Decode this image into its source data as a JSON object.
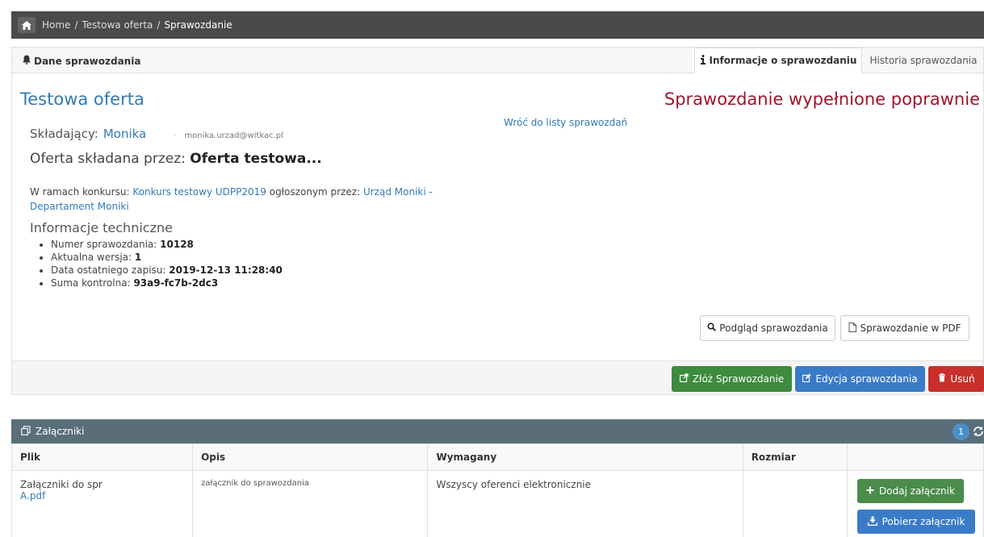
{
  "breadcrumb": {
    "home": "Home",
    "offer": "Testowa oferta",
    "current": "Sprawozdanie",
    "separator": "/"
  },
  "panel": {
    "title": "Dane sprawozdania",
    "tabs": [
      {
        "label": "Informacje o sprawozdaniu",
        "active": true
      },
      {
        "label": "Historia sprawozdania",
        "active": false
      }
    ]
  },
  "offer": {
    "title": "Testowa oferta",
    "status": "Sprawozdanie wypełnione poprawnie",
    "back_link": "Wróć do listy sprawozdań",
    "submitter_label": "Składający:",
    "submitter_name": "Monika",
    "submitter_sep": "·",
    "submitter_email": "monika.urzad@witkac.pl",
    "offered_by_label": "Oferta składana przez:",
    "offered_by_value": "Oferta testowa...",
    "contest_prefix": "W ramach konkursu:",
    "contest_name": "Konkurs testowy UDPP2019",
    "announced_by_label": "ogłoszonym przez:",
    "announced_by": "Urząd Moniki - Departament Moniki"
  },
  "tech": {
    "heading": "Informacje techniczne",
    "items": [
      {
        "label": "Numer sprawozdania:",
        "value": "10128"
      },
      {
        "label": "Aktualna wersja:",
        "value": "1"
      },
      {
        "label": "Data ostatniego zapisu:",
        "value": "2019-12-13 11:28:40"
      },
      {
        "label": "Suma kontrolna:",
        "value": "93a9-fc7b-2dc3"
      }
    ]
  },
  "actions": {
    "preview": "Podgląd sprawozdania",
    "pdf": "Sprawozdanie w PDF",
    "submit": "Złóż Sprawozdanie",
    "edit": "Edycja sprawozdania",
    "delete": "Usuń"
  },
  "attachments": {
    "title": "Załączniki",
    "count": "1",
    "columns": [
      "Plik",
      "Opis",
      "Wymagany",
      "Rozmiar"
    ],
    "rows": [
      {
        "file_name": "Załączniki do spr",
        "file_link": "A.pdf",
        "description": "załącznik do sprawozdania",
        "required": "Wszyscy oferenci elektronicznie",
        "size": ""
      }
    ],
    "add_label": "Dodaj załącznik",
    "download_label": "Pobierz załącznik"
  },
  "colors": {
    "link": "#337ab7",
    "status": "#a2142a",
    "success": "#3d8b3d",
    "primary": "#3a7bc8",
    "danger": "#c9302c",
    "header_bar": "#5a6e7a"
  }
}
